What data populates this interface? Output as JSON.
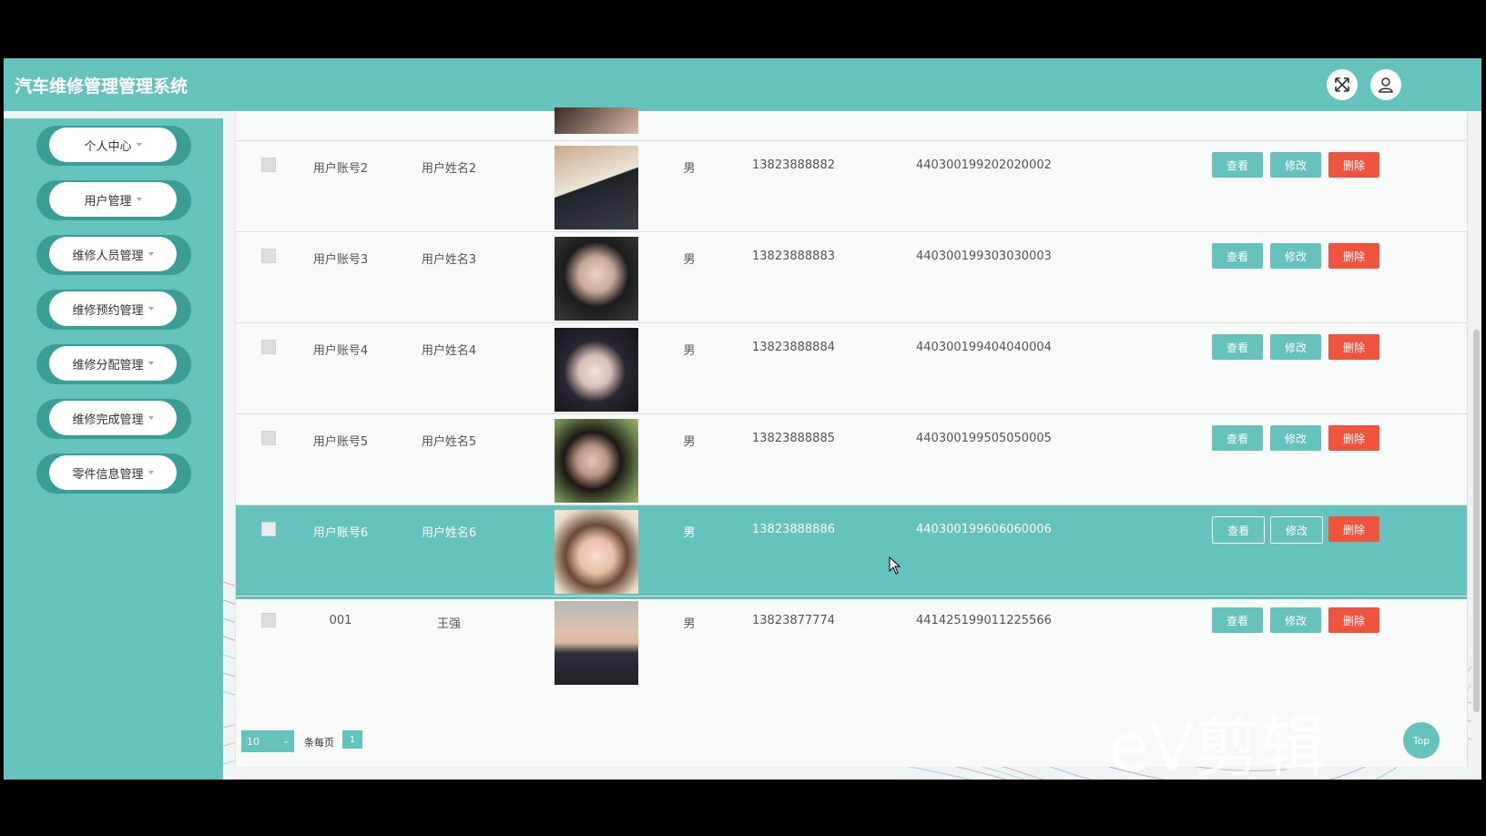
{
  "app": {
    "title": "汽车维修管理管理系统"
  },
  "header": {
    "fullscreen_icon": "fullscreen-icon",
    "user_icon": "user-icon"
  },
  "sidebar": {
    "items": [
      {
        "label": "个人中心"
      },
      {
        "label": "用户管理"
      },
      {
        "label": "维修人员管理"
      },
      {
        "label": "维修预约管理"
      },
      {
        "label": "维修分配管理"
      },
      {
        "label": "维修完成管理"
      },
      {
        "label": "零件信息管理"
      }
    ]
  },
  "table": {
    "actions": {
      "view": "查看",
      "edit": "修改",
      "delete": "删除"
    },
    "rows": [
      {
        "account": "用户账号2",
        "name": "用户姓名2",
        "gender": "男",
        "phone": "13823888882",
        "id_card": "440300199202020002"
      },
      {
        "account": "用户账号3",
        "name": "用户姓名3",
        "gender": "男",
        "phone": "13823888883",
        "id_card": "440300199303030003"
      },
      {
        "account": "用户账号4",
        "name": "用户姓名4",
        "gender": "男",
        "phone": "13823888884",
        "id_card": "440300199404040004"
      },
      {
        "account": "用户账号5",
        "name": "用户姓名5",
        "gender": "男",
        "phone": "13823888885",
        "id_card": "440300199505050005"
      },
      {
        "account": "用户账号6",
        "name": "用户姓名6",
        "gender": "男",
        "phone": "13823888886",
        "id_card": "440300199606060006"
      },
      {
        "account": "001",
        "name": "王强",
        "gender": "男",
        "phone": "13823877774",
        "id_card": "441425199011225566"
      }
    ]
  },
  "pagination": {
    "page_size": "10",
    "page_size_label": "条每页",
    "current_page": "1"
  },
  "top_button": "Top",
  "watermark": "eV剪辑",
  "colors": {
    "primary": "#66c2bc",
    "danger": "#f0533e"
  }
}
